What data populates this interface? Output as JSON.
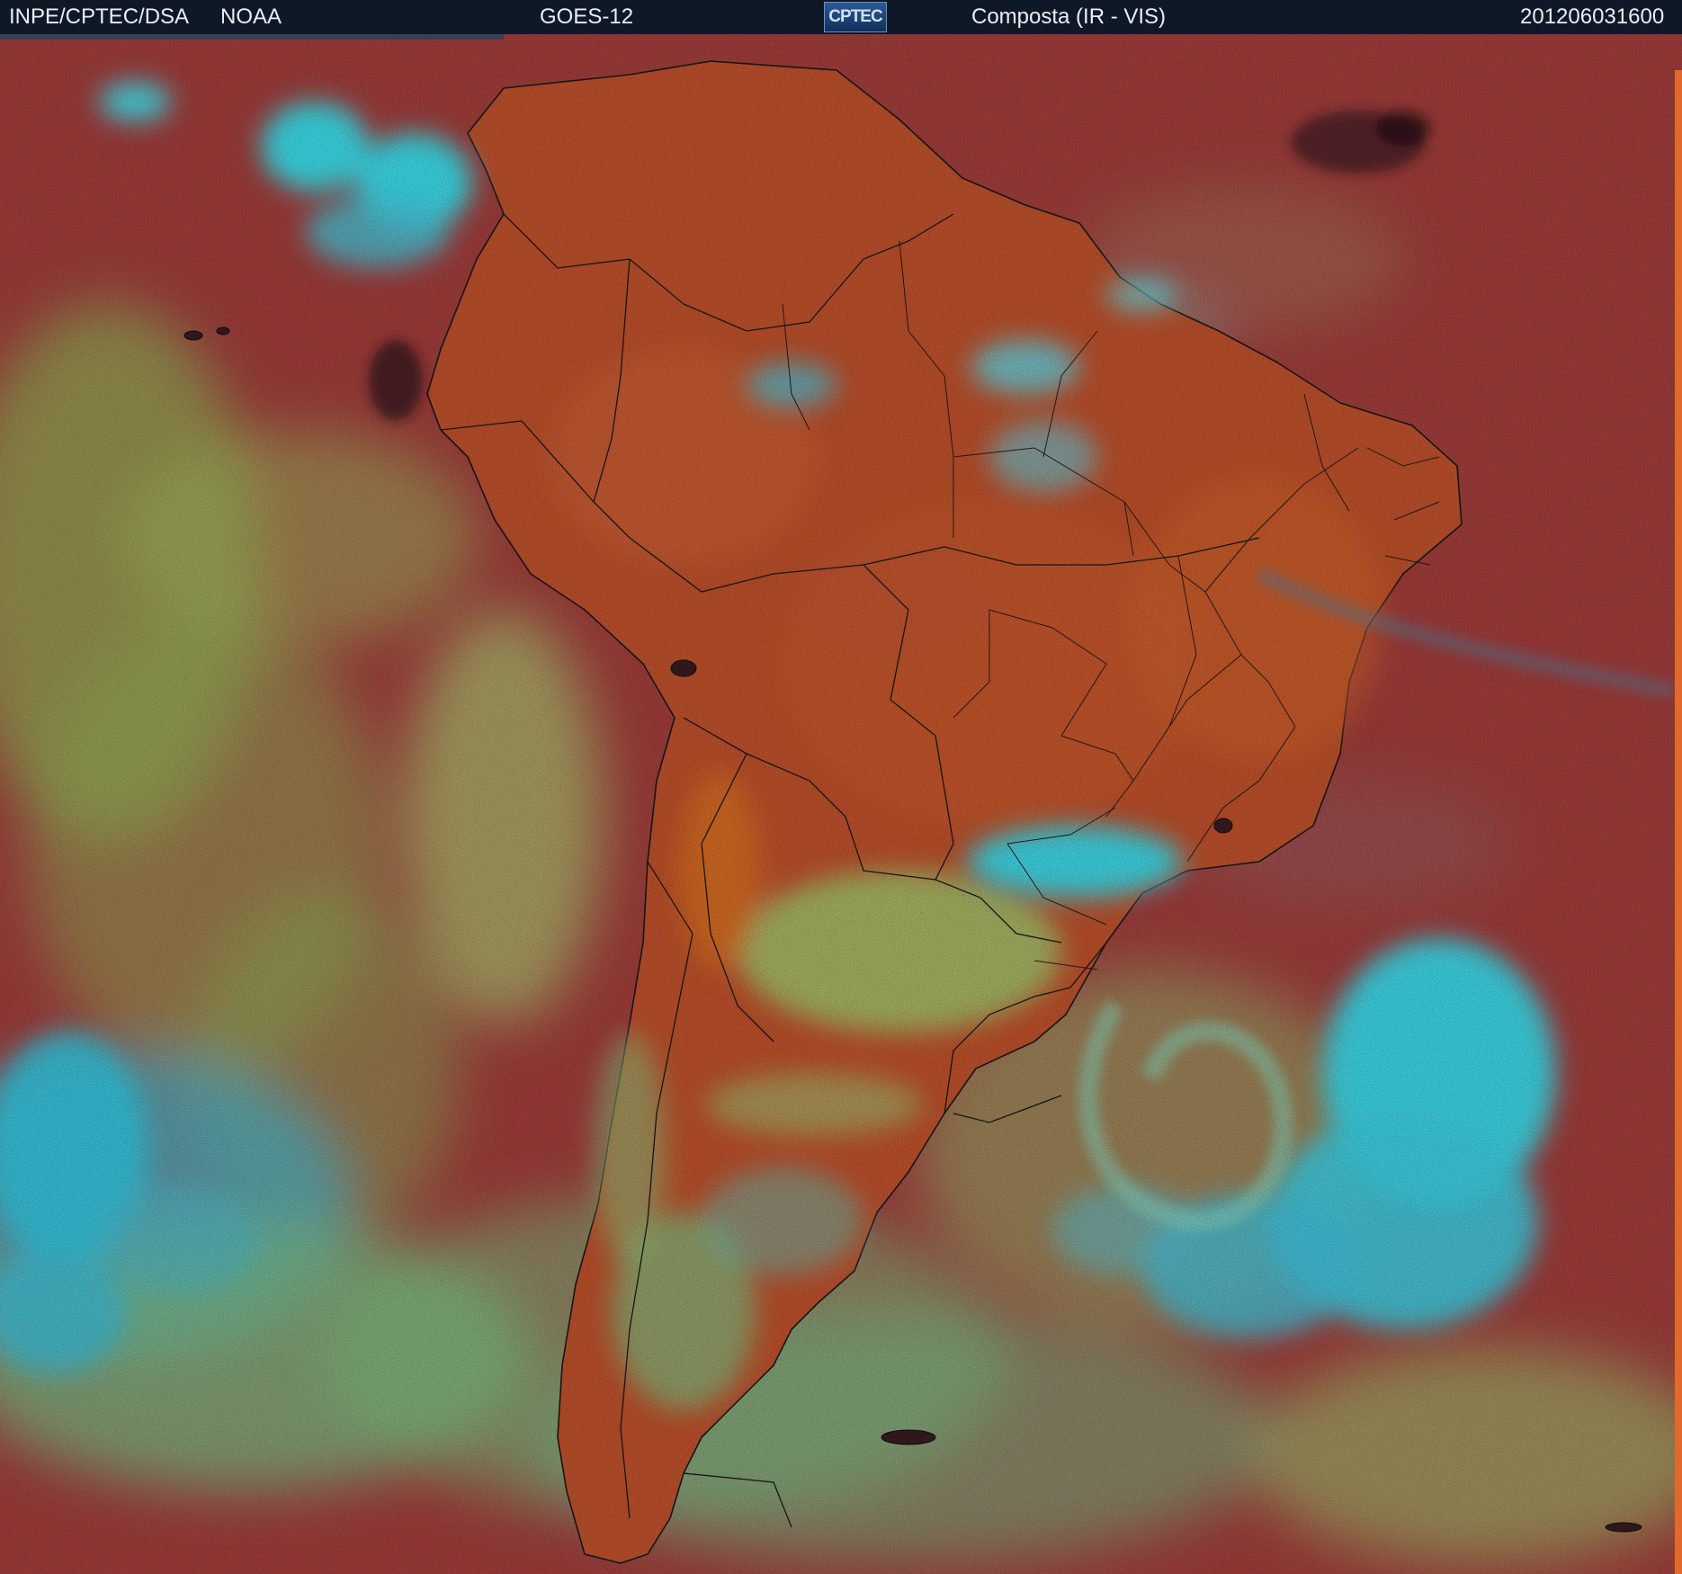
{
  "header": {
    "agency": "INPE/CPTEC/DSA",
    "partner": "NOAA",
    "satellite": "GOES-12",
    "logo_text": "CPTEC",
    "product": "Composta (IR - VIS)",
    "timestamp": "201206031600"
  },
  "colors": {
    "header_background": "#0f1826",
    "header_text": "#e8eef4",
    "ocean_clear": "#a9413f",
    "land": "#c8552e",
    "deep_convection": "#39e0f0",
    "low_cloud": "#93d86c",
    "borders": "#1a1a1a"
  },
  "map": {
    "projection": "satellite composite",
    "region": "South America",
    "features": [
      "coastline",
      "country-borders",
      "state-borders",
      "cloud-cover"
    ]
  }
}
